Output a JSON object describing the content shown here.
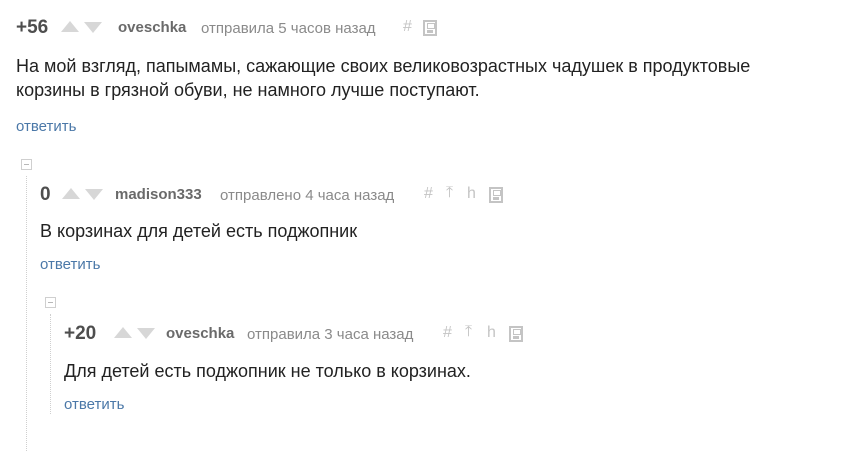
{
  "comments": [
    {
      "rating": "+56",
      "username": "oveschka",
      "meta": "отправила 5 часов назад",
      "text_line1": "На мой взгляд, папымамы, сажающие своих великовозрастных чадушек в продуктовые",
      "text_line2": "корзины в грязной обуви, не намного лучше поступают.",
      "reply_label": "ответить"
    },
    {
      "rating": "0",
      "username": "madison333",
      "meta": "отправлено 4 часа назад",
      "text": "В корзинах для детей есть поджопник",
      "reply_label": "ответить"
    },
    {
      "rating": "+20",
      "username": "oveschka",
      "meta": "отправила 3 часа назад",
      "text": "Для детей есть поджопник не только в корзинах.",
      "reply_label": "ответить"
    }
  ],
  "icons": {
    "hash": "#",
    "parent": "⤒",
    "branch": "h"
  },
  "colors": {
    "reply_link": "#4b78a8",
    "rating": "#4e4e4e",
    "meta": "#8a8a8a",
    "arrow": "#d7d7d7"
  }
}
